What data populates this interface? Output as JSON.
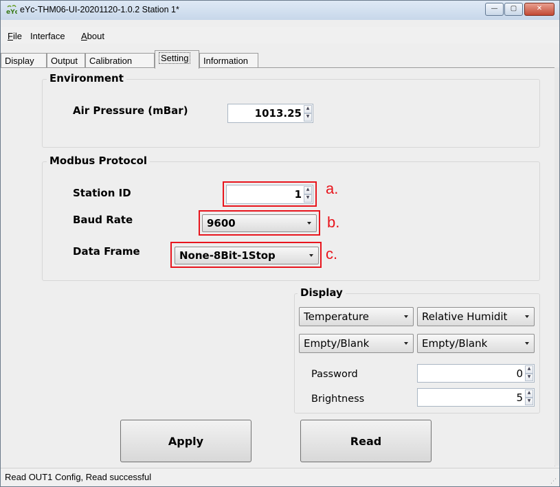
{
  "window": {
    "title": "eYc-THM06-UI-20201120-1.0.2  Station 1*",
    "icon_name": "eyc-logo-icon",
    "controls": {
      "minimize": "—",
      "maximize": "▢",
      "close": "✕"
    }
  },
  "menu": {
    "items": [
      {
        "label": "File",
        "mnemonic": "F",
        "rest": "ile"
      },
      {
        "label": "Interface",
        "mnemonic": "",
        "rest": "Interface"
      },
      {
        "label": "About",
        "mnemonic": "A",
        "rest": "bout"
      }
    ]
  },
  "tabs": [
    {
      "label": "Display"
    },
    {
      "label": "Output"
    },
    {
      "label": "Calibration"
    },
    {
      "label": "Setting",
      "active": true
    },
    {
      "label": "Information"
    }
  ],
  "environment": {
    "title": "Environment",
    "air_pressure_label": "Air Pressure (mBar)",
    "air_pressure_value": "1013.25"
  },
  "modbus": {
    "title": "Modbus Protocol",
    "station_id_label": "Station ID",
    "station_id_value": "1",
    "baud_rate_label": "Baud Rate",
    "baud_rate_value": "9600",
    "data_frame_label": "Data Frame",
    "data_frame_value": "None-8Bit-1Stop"
  },
  "annotations": {
    "a": "a.",
    "b": "b.",
    "c": "c.",
    "highlight_color": "#e8141c"
  },
  "display": {
    "title": "Display",
    "select_1": "Temperature",
    "select_2": "Relative Humidit",
    "select_3": "Empty/Blank",
    "select_4": "Empty/Blank",
    "password_label": "Password",
    "password_value": "0",
    "brightness_label": "Brightness",
    "brightness_value": "5"
  },
  "buttons": {
    "apply": "Apply",
    "read": "Read"
  },
  "status": {
    "text": "Read OUT1 Config,   Read successful"
  }
}
